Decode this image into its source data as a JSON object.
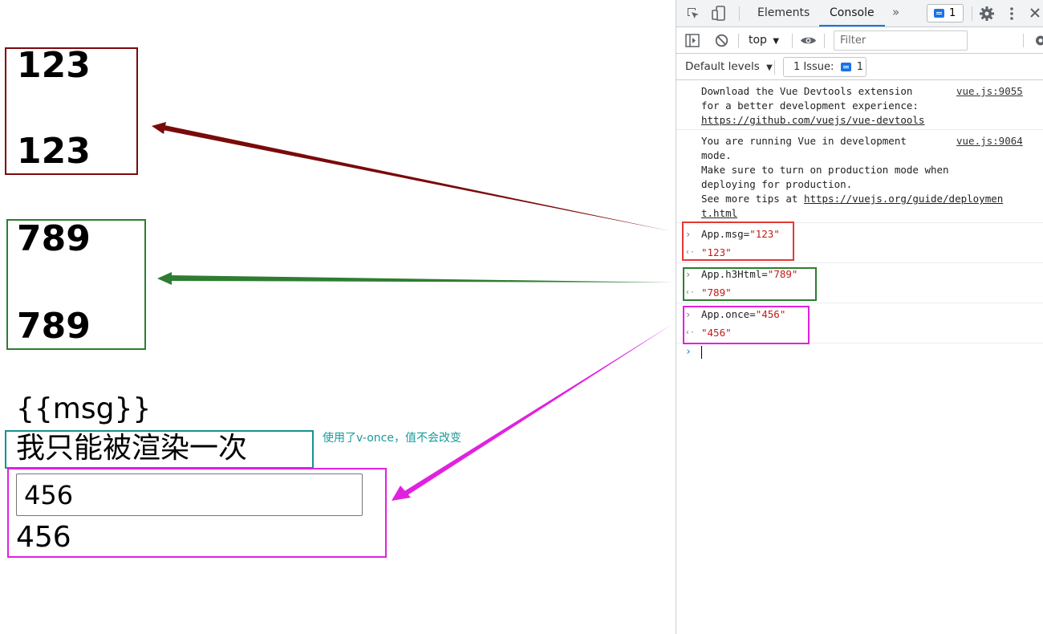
{
  "page": {
    "block1": {
      "line1": "123",
      "line2": "123"
    },
    "block2": {
      "line1": "789",
      "line2": "789"
    },
    "template_text": "{{msg}}",
    "once_text": "我只能被渲染一次",
    "annotation": "使用了v-once，值不会改变",
    "input_value": "456",
    "bound_text": "456"
  },
  "devtools": {
    "tabs": {
      "elements": "Elements",
      "console": "Console"
    },
    "messages_badge": "1",
    "context": "top",
    "filter_placeholder": "Filter",
    "levels": "Default levels",
    "issues_label": "1 Issue:",
    "issues_count": "1"
  },
  "console": {
    "info": [
      {
        "lines": [
          "Download the Vue Devtools extension",
          "for a better development experience:"
        ],
        "link": "https://github.com/vuejs/vue-devtools",
        "source": "vue.js:9055"
      },
      {
        "lines": [
          "You are running Vue in development",
          "mode.",
          "Make sure to turn on production mode when",
          "deploying for production."
        ],
        "prefix": "See more tips at ",
        "link1": "https://vuejs.org/guide/deploymen",
        "link2": "t.html",
        "source": "vue.js:9064"
      }
    ],
    "commands": [
      {
        "expr": "App.msg=",
        "value": "\"123\"",
        "result": "\"123\""
      },
      {
        "expr": "App.h3Html=",
        "value": "\"789\"",
        "result": "\"789\""
      },
      {
        "expr": "App.once=",
        "value": "\"456\"",
        "result": "\"456\""
      }
    ]
  },
  "colors": {
    "box_red": "#7a0a0a",
    "box_green": "#2e7d32",
    "box_teal": "#16938f",
    "box_magenta": "#e022e0",
    "console_red_box": "#e53935",
    "annotation_teal": "#1a9a9a"
  }
}
